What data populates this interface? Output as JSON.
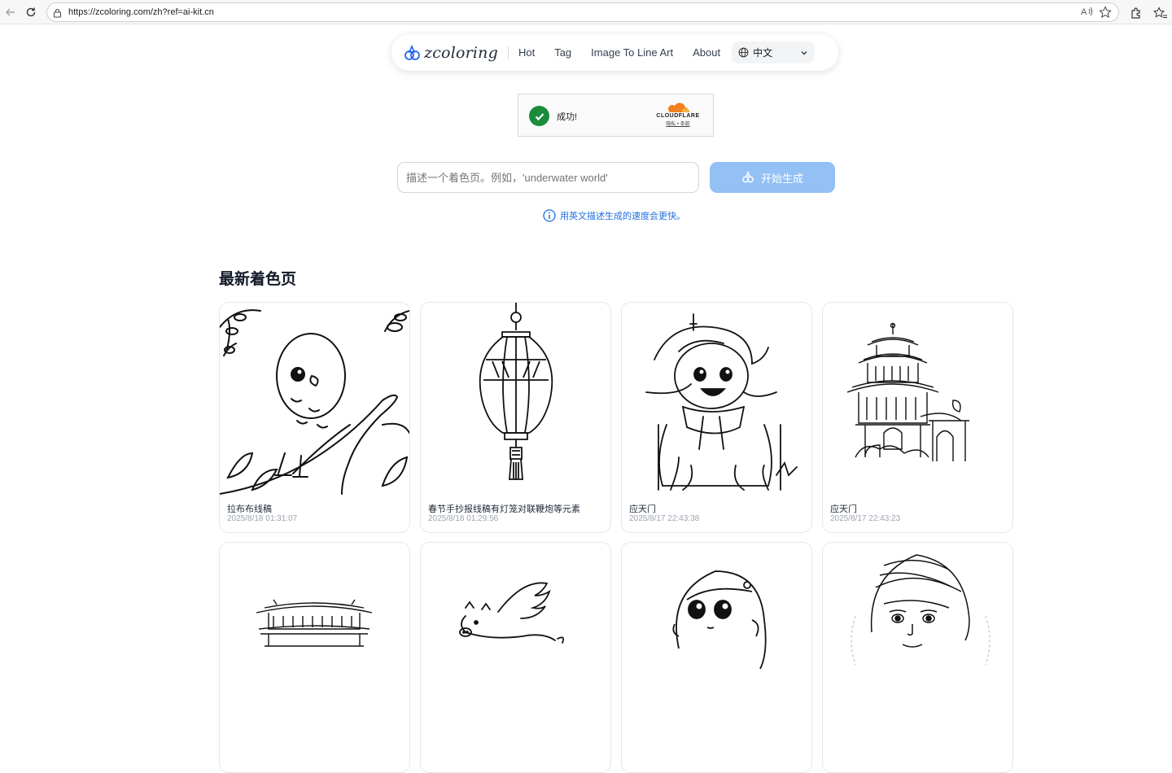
{
  "browser": {
    "url": "https://zcoloring.com/zh?ref=ai-kit.cn",
    "read_aloud_label": "A⁾"
  },
  "header": {
    "logo_text": "zcoloring",
    "nav": [
      "Hot",
      "Tag",
      "Image To Line Art",
      "About"
    ],
    "language": "中文"
  },
  "captcha": {
    "status": "成功!",
    "brand": "CLOUDFLARE",
    "links": "隐私 • 条款"
  },
  "prompt": {
    "placeholder": "描述一个着色页。例如，'underwater world'",
    "button_label": "开始生成",
    "hint": "用英文描述生成的速度会更快。"
  },
  "section": {
    "title": "最新着色页"
  },
  "cards": [
    {
      "title": "拉布布线稿",
      "date": "2025/8/18 01:31:07",
      "icon": "bird-line-art"
    },
    {
      "title": "春节手抄报线稿有灯笼对联鞭炮等元素",
      "date": "2025/8/18 01:29:56",
      "icon": "lantern-line-art"
    },
    {
      "title": "应天门",
      "date": "2025/8/17 22:43:38",
      "icon": "child-line-art"
    },
    {
      "title": "应天门",
      "date": "2025/8/17 22:43:23",
      "icon": "pagoda-line-art"
    },
    {
      "title": "",
      "date": "",
      "icon": "palace-line-art"
    },
    {
      "title": "",
      "date": "",
      "icon": "flying-pig-line-art"
    },
    {
      "title": "",
      "date": "",
      "icon": "girl-face-line-art"
    },
    {
      "title": "",
      "date": "",
      "icon": "princess-line-art"
    }
  ],
  "colors": {
    "accent": "#93c0f5",
    "link": "#1d6fe0",
    "success": "#1a8c3c",
    "cloudflare": "#f38020"
  }
}
